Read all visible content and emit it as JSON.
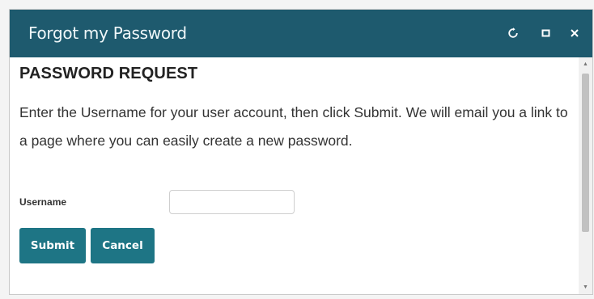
{
  "dialog": {
    "title": "Forgot my Password",
    "controls": {
      "refresh_icon": "refresh-icon",
      "maximize_icon": "maximize-icon",
      "close_icon": "close-icon"
    }
  },
  "content": {
    "heading": "PASSWORD REQUEST",
    "instructions": "Enter the Username for your user account, then click Submit. We will email you a link to a page where you can easily create a new password.",
    "username_label": "Username",
    "username_value": "",
    "username_placeholder": ""
  },
  "buttons": {
    "submit": "Submit",
    "cancel": "Cancel"
  },
  "colors": {
    "titlebar": "#1e5a6e",
    "button": "#1e7585"
  }
}
